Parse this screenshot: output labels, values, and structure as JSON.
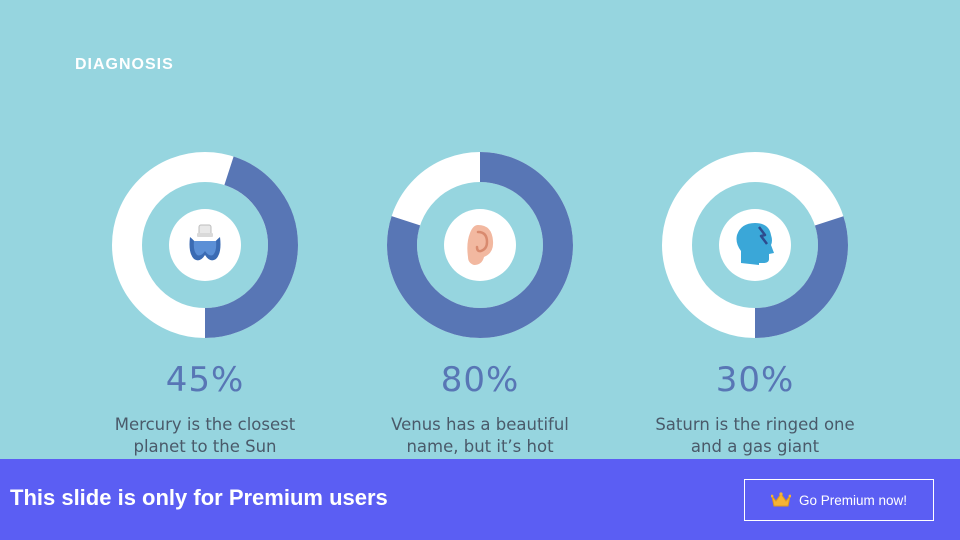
{
  "slide": {
    "title": "DIAGNOSIS"
  },
  "stats": [
    {
      "value": "45%",
      "percent": 45,
      "description": "Mercury is the closest planet to the Sun",
      "icon": "thyroid-icon"
    },
    {
      "value": "80%",
      "percent": 80,
      "description": "Venus has a beautiful name, but it’s hot",
      "icon": "ear-icon"
    },
    {
      "value": "30%",
      "percent": 30,
      "description": "Saturn is the ringed one and a gas giant",
      "icon": "head-pain-icon"
    }
  ],
  "colors": {
    "background": "#96d5df",
    "accent": "#5876b5",
    "ring": "#ffffff",
    "banner": "#5b5ef3"
  },
  "banner": {
    "text": "This slide is only for Premium users",
    "button_label": "Go Premium now!",
    "button_icon": "crown-icon"
  }
}
